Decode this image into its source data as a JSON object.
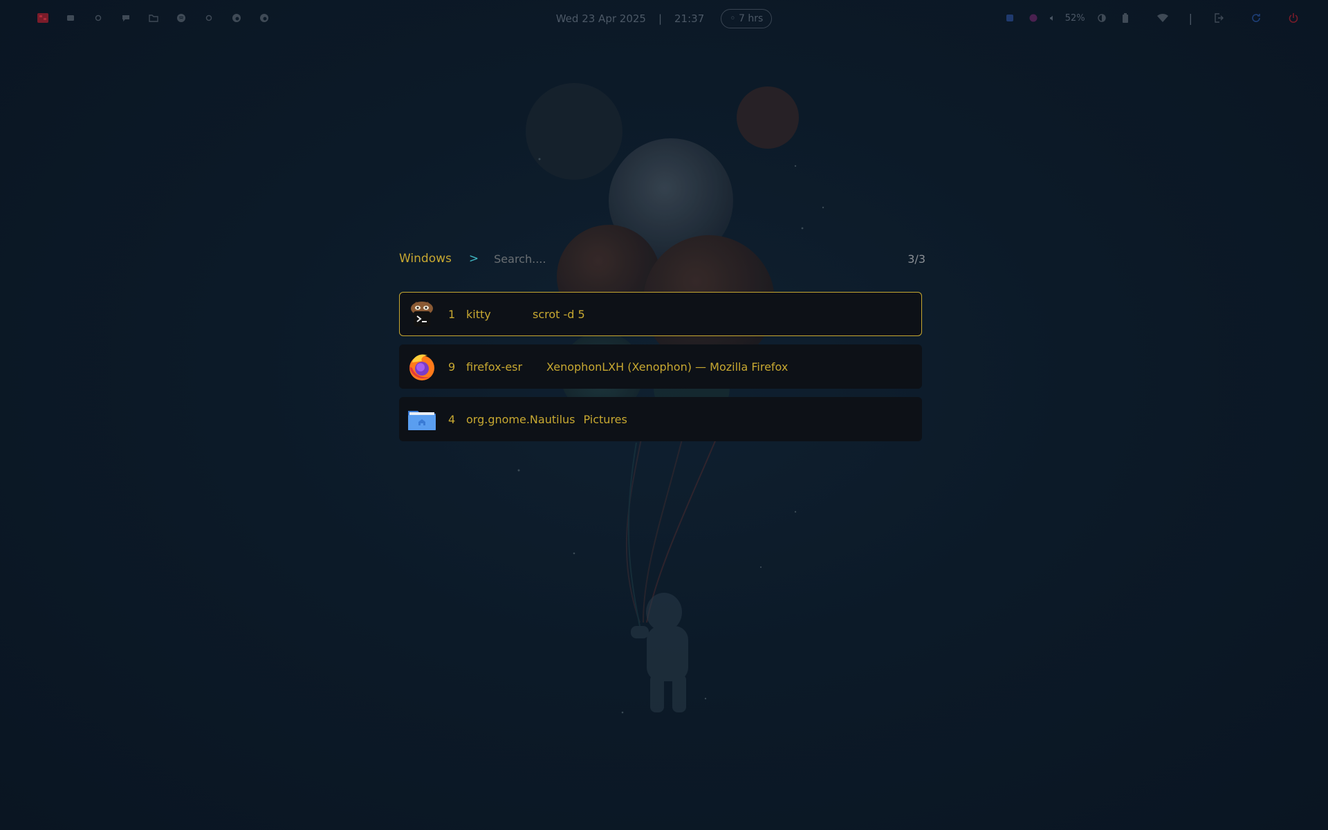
{
  "topbar": {
    "left_icons": [
      "app-icon",
      "message-icon",
      "circle-icon",
      "chat-icon",
      "folder-icon",
      "spotify-icon",
      "circle-icon",
      "fire-icon",
      "fire-icon"
    ],
    "date": "Wed 23 Apr 2025",
    "separator": "|",
    "time": "21:37",
    "uptime_label": "7 hrs",
    "volume": "52%",
    "divider": "|"
  },
  "launcher": {
    "mode_label": "Windows",
    "prompt": ">",
    "search_placeholder": "Search....",
    "search_value": "",
    "counter": "3/3",
    "results": [
      {
        "workspace": "1",
        "class": "kitty",
        "title": "scrot -d 5",
        "icon": "kitty-icon",
        "selected": true
      },
      {
        "workspace": "9",
        "class": "firefox-esr",
        "title": "XenophonLXH (Xenophon) — Mozilla Firefox",
        "icon": "firefox-icon",
        "selected": false
      },
      {
        "workspace": "4",
        "class": "org.gnome.Nautilus",
        "title": "Pictures",
        "icon": "folder-icon",
        "selected": false
      }
    ]
  },
  "colors": {
    "accent": "#c7a831",
    "prompt": "#3fb6c2",
    "row_bg": "#0d1117",
    "background": "#0c1a28"
  }
}
